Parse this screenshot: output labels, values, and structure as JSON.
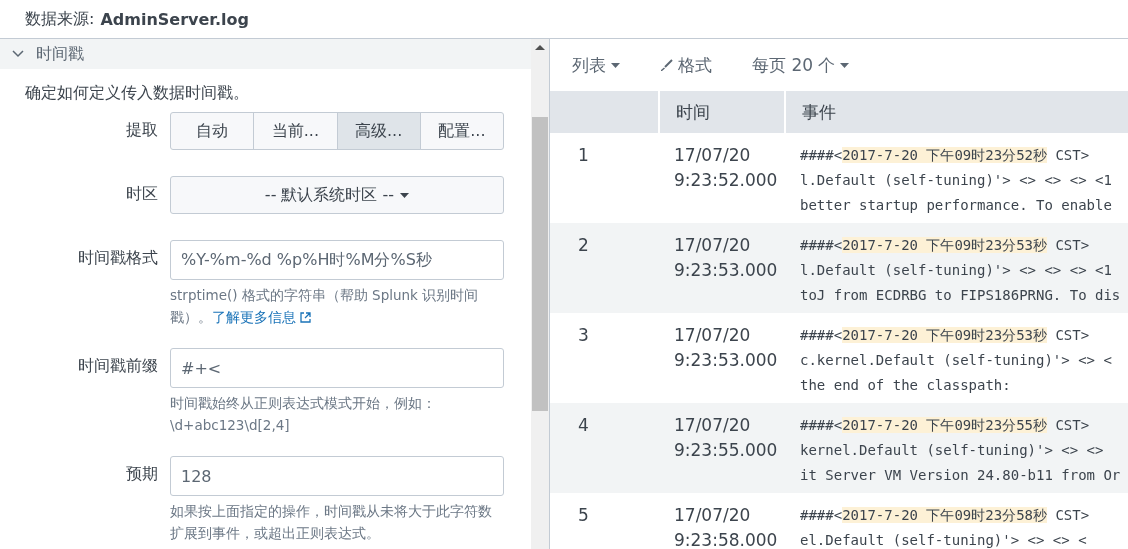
{
  "header": {
    "label": "数据来源:",
    "source": "AdminServer.log"
  },
  "section": {
    "title": "时间戳",
    "expanded": true,
    "description": "确定如何定义传入数据时间戳。",
    "extraction": {
      "label": "提取",
      "options": [
        {
          "label": "自动",
          "selected": false
        },
        {
          "label": "当前...",
          "selected": false
        },
        {
          "label": "高级...",
          "selected": true
        },
        {
          "label": "配置...",
          "selected": false
        }
      ]
    },
    "timezone": {
      "label": "时区",
      "value": "-- 默认系统时区 --"
    },
    "fields": [
      {
        "label": "时间戳格式",
        "value": "%Y-%m-%d %p%H时%M分%S秒",
        "help": "strptime() 格式的字符串（帮助 Splunk 识别时间戳）。",
        "link": "了解更多信息"
      },
      {
        "label": "时间戳前缀",
        "value": "#+<",
        "help": "时间戳始终从正则表达式模式开始，例如：\\d+abc123\\d[2,4]"
      },
      {
        "label": "预期",
        "value": "128",
        "help": "如果按上面指定的操作，时间戳从未将大于此字符数扩展到事件，或超出正则表达式。"
      }
    ]
  },
  "toolbar": {
    "list": "列表",
    "format": "格式",
    "per_page": "每页 20 个"
  },
  "table": {
    "columns": [
      "时间",
      "事件"
    ],
    "rows": [
      {
        "index": "1",
        "date": "17/07/20",
        "time": "9:23:52.000",
        "prefix": "####<",
        "timestamp": "2017-7-20 下午09时23分52秒",
        "rest": " CST>",
        "lines": [
          "l.Default (self-tuning)'> <> <> <> <1",
          "better startup performance. To enable"
        ]
      },
      {
        "index": "2",
        "date": "17/07/20",
        "time": "9:23:53.000",
        "prefix": "####<",
        "timestamp": "2017-7-20 下午09时23分53秒",
        "rest": " CST>",
        "lines": [
          "l.Default (self-tuning)'> <> <> <> <1",
          "toJ from ECDRBG to FIPS186PRNG. To dis"
        ]
      },
      {
        "index": "3",
        "date": "17/07/20",
        "time": "9:23:53.000",
        "prefix": "####<",
        "timestamp": "2017-7-20 下午09时23分53秒",
        "rest": " CST>",
        "lines": [
          "c.kernel.Default (self-tuning)'> <> <",
          "the end of the classpath:"
        ]
      },
      {
        "index": "4",
        "date": "17/07/20",
        "time": "9:23:55.000",
        "prefix": "####<",
        "timestamp": "2017-7-20 下午09时23分55秒",
        "rest": " CST>",
        "lines": [
          "kernel.Default (self-tuning)'> <> <>",
          "it Server VM Version 24.80-b11 from Or"
        ]
      },
      {
        "index": "5",
        "date": "17/07/20",
        "time": "9:23:58.000",
        "prefix": "####<",
        "timestamp": "2017-7-20 下午09时23分58秒",
        "rest": " CST>",
        "lines": [
          "el.Default (self-tuning)'> <> <> <"
        ]
      }
    ]
  }
}
